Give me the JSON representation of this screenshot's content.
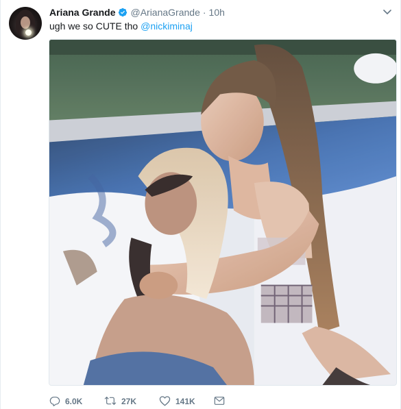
{
  "tweet": {
    "author_name": "Ariana Grande",
    "author_handle": "@ArianaGrande",
    "separator": "·",
    "time": "10h",
    "text": "ugh we so CUTE tho",
    "mention": "@nickiminaj",
    "verified": true
  },
  "actions": {
    "replies": "6.0K",
    "retweets": "27K",
    "likes": "141K"
  },
  "icons": {
    "reply": "reply-icon",
    "retweet": "retweet-icon",
    "like": "heart-icon",
    "message": "envelope-icon",
    "menu": "chevron-down-icon",
    "verified": "verified-badge-icon"
  },
  "colors": {
    "link": "#1da1f2",
    "muted": "#657786",
    "text": "#14171a"
  }
}
